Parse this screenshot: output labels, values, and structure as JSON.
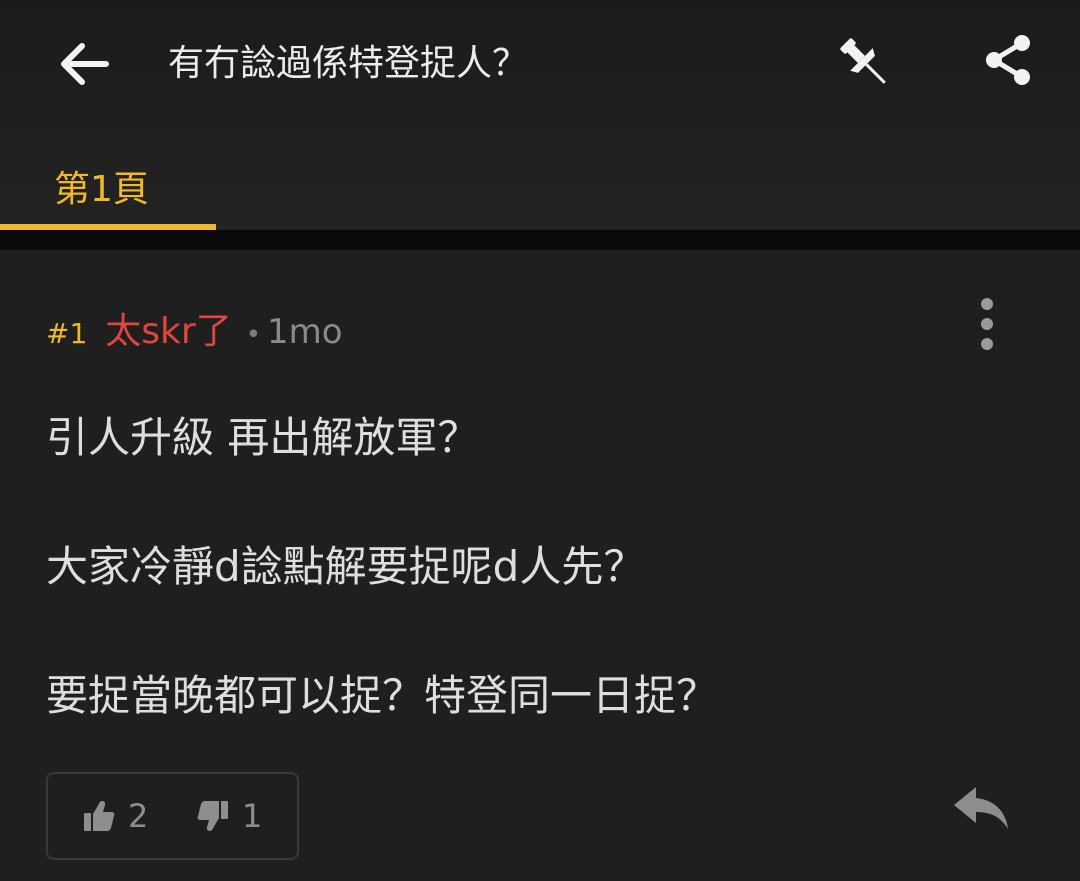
{
  "header": {
    "title": "有冇諗過係特登捉人？",
    "back_icon": "arrow-left-icon",
    "pin_icon": "pushpin-icon",
    "share_icon": "share-icon"
  },
  "tabs": [
    {
      "label": "第1頁",
      "active": true
    }
  ],
  "colors": {
    "accent": "#f0b92a",
    "author": "#e0453f",
    "background": "#1f1f1f"
  },
  "post": {
    "number": "#1",
    "author": "太skr了",
    "separator": "•",
    "time": "1mo",
    "lines": [
      "引人升級 再出解放軍？",
      "大家冷靜d諗點解要捉呢d人先？",
      "要捉當晚都可以捉？特登同一日捉？"
    ],
    "likes": "2",
    "dislikes": "1",
    "more_icon": "more-vertical-icon",
    "like_icon": "thumbs-up-icon",
    "dislike_icon": "thumbs-down-icon",
    "reply_icon": "reply-icon"
  }
}
